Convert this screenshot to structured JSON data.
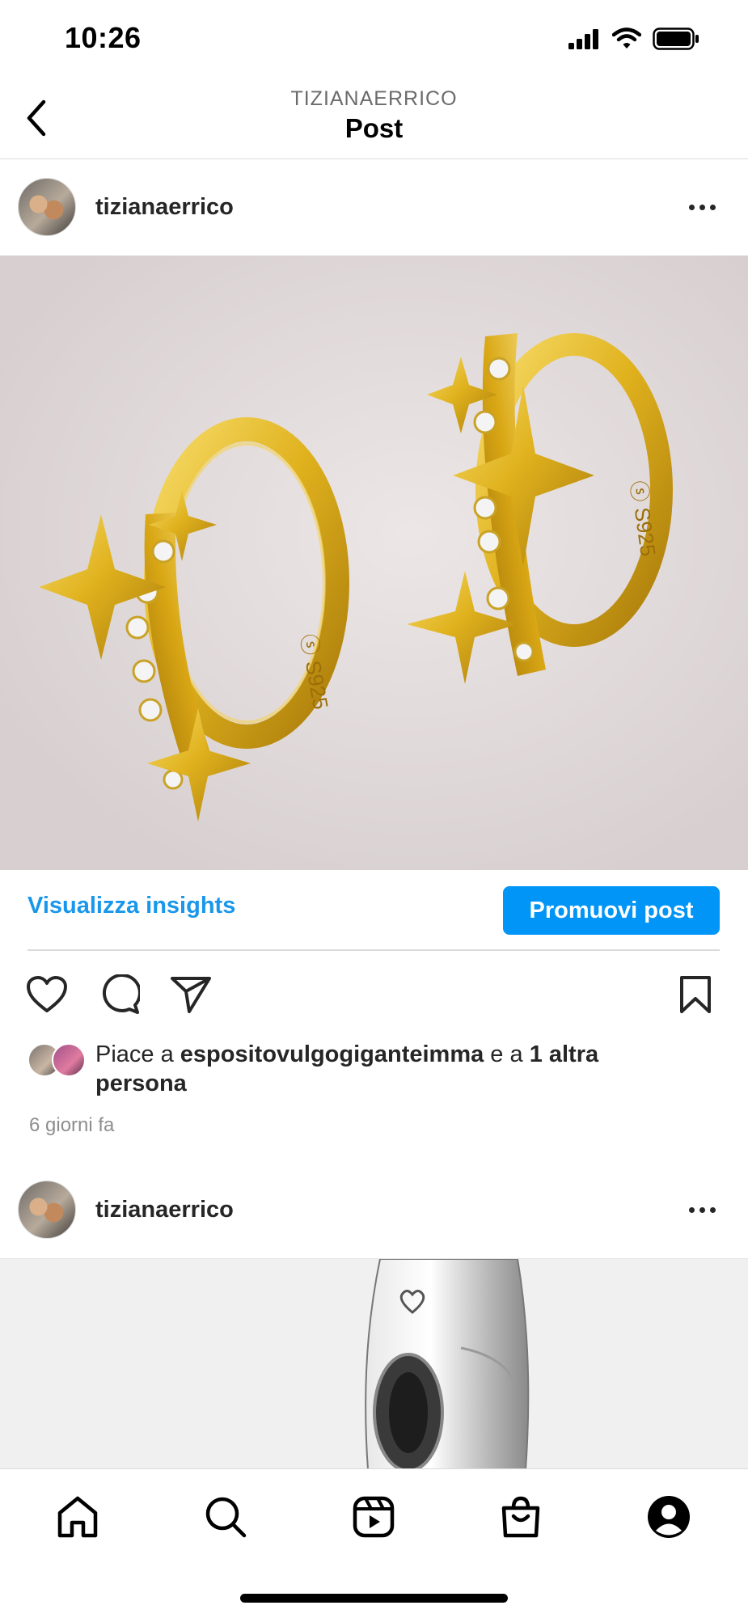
{
  "status_bar": {
    "time": "10:26"
  },
  "header": {
    "subtitle": "TIZIANAERRICO",
    "title": "Post"
  },
  "post": {
    "username": "tizianaerrico",
    "insights_label": "Visualizza insights",
    "promote_label": "Promuovi post",
    "likes": {
      "prefix": "Piace a ",
      "liker": "espositovulgogiganteimma",
      "middle": " e a ",
      "others": "1 altra persona"
    },
    "time_ago": "6 giorni fa",
    "image_engraving": "S925"
  },
  "next_post": {
    "username": "tizianaerrico"
  },
  "icons": {
    "back": "chevron-left-icon",
    "more": "more-horizontal-icon",
    "like": "heart-icon",
    "comment": "comment-icon",
    "share": "paper-plane-icon",
    "save": "bookmark-icon",
    "tabs": [
      "home-icon",
      "search-icon",
      "reels-icon",
      "shop-icon",
      "profile-icon"
    ]
  },
  "colors": {
    "accent": "#0095f6",
    "link": "#1a97ea",
    "text": "#262626",
    "muted": "#8e8e8e"
  }
}
